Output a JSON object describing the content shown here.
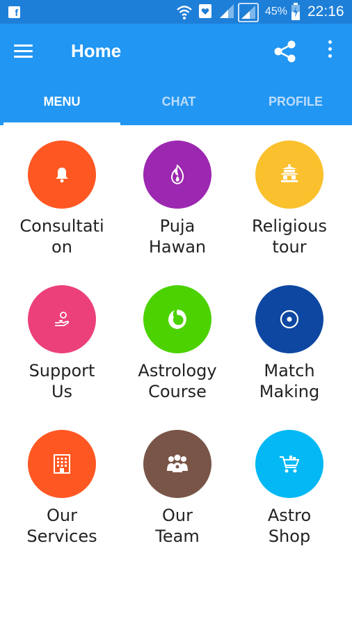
{
  "status_bar": {
    "battery_percent": "45%",
    "time": "22:16",
    "icons": [
      "facebook-icon",
      "wifi-icon",
      "notification-icon",
      "signal-icon",
      "signal-icon",
      "battery-icon"
    ]
  },
  "app_bar": {
    "title": "Home",
    "color": "#2196f3"
  },
  "tabs": [
    {
      "label": "MENU",
      "active": true
    },
    {
      "label": "CHAT",
      "active": false
    },
    {
      "label": "PROFILE",
      "active": false
    }
  ],
  "menu": [
    {
      "label": "Consultati\non",
      "color": "#ff5722",
      "icon": "bell-icon"
    },
    {
      "label": "Puja\nHawan",
      "color": "#9c27b0",
      "icon": "flame-icon"
    },
    {
      "label": "Religious\ntour",
      "color": "#fbc02d",
      "icon": "temple-icon"
    },
    {
      "label": "Support\nUs",
      "color": "#ec407a",
      "icon": "donate-hand-icon"
    },
    {
      "label": "Astrology\nCourse",
      "color": "#4cd200",
      "icon": "leo-lion-icon"
    },
    {
      "label": "Match\nMaking",
      "color": "#0d47a1",
      "icon": "target-icon"
    },
    {
      "label": "Our\nServices",
      "color": "#ff5722",
      "icon": "building-icon"
    },
    {
      "label": "Our\nTeam",
      "color": "#795548",
      "icon": "team-icon"
    },
    {
      "label": "Astro\nShop",
      "color": "#03b8f4",
      "icon": "cart-icon"
    }
  ]
}
